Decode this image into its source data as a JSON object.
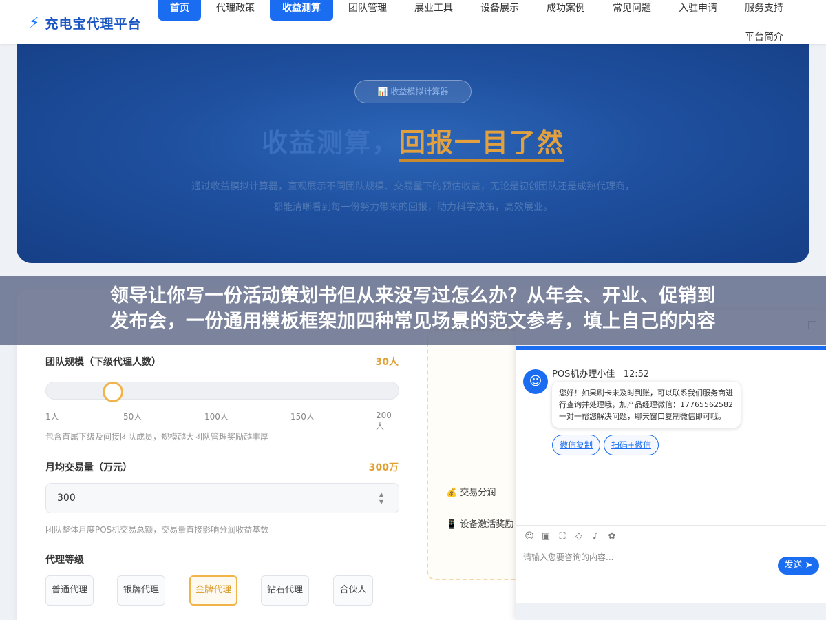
{
  "header": {
    "logo_icon": "⚡",
    "logo_text": "充电宝代理平台",
    "nav": [
      "首页",
      "代理政策",
      "收益测算",
      "团队管理",
      "展业工具",
      "设备展示",
      "成功案例",
      "常见问题",
      "入驻申请",
      "服务支持",
      "平台简介"
    ],
    "active_nav": [
      "首页",
      "收益测算"
    ]
  },
  "hero": {
    "badge": "📊 收益模拟计算器",
    "title_part1": "收益测算，",
    "title_part2": "回报一目了然",
    "description": "通过收益模拟计算器，直观展示不同团队规模、交易量下的预估收益，无论是初创团队还是成熟代理商，都能清晰看到每一份努力带来的回报，助力科学决策，高效展业。"
  },
  "banner": {
    "line1": "领导让你写一份活动策划书但从来没写过怎么办？从年会、开业、促销到",
    "line2": "发布会，一份通用模板框架加四种常见场景的范文参考，填上自己的内容"
  },
  "calculator": {
    "team_label": "团队规模（下级代理人数）",
    "team_value": "30人",
    "team_slider_fraction": 0.15,
    "team_ticks": [
      "1人",
      "50人",
      "100人",
      "150人",
      "200人"
    ],
    "team_hint": "包含直属下级及间接团队成员，规模越大团队管理奖励越丰厚",
    "volume_label": "月均交易量（万元）",
    "volume_value": "300万",
    "volume_input": "300",
    "volume_hint": "团队整体月度POS机交易总额，交易量直接影响分润收益基数",
    "level_label": "代理等级",
    "levels": [
      "普通代理",
      "银牌代理",
      "金牌代理",
      "钻石代理",
      "合伙人"
    ],
    "active_level": "金牌代理",
    "income_items": [
      "💰 交易分润",
      "📱 设备激活奖励"
    ]
  },
  "chat": {
    "agent_name": "POS机办理小佳",
    "time": "12:52",
    "message": "您好！如果刷卡未及时到账，可以联系我们服务商进行查询并处理哦，加产品经理微信：17765562582 一对一帮您解决问题，聊天窗口复制微信即可哦。",
    "buttons": [
      "微信复制",
      "扫码+微信"
    ],
    "tool_icons": [
      "emoji-icon",
      "image-icon",
      "screenshot-icon",
      "tag-icon",
      "voice-icon",
      "rating-icon"
    ],
    "input_placeholder": "请输入您要咨询的内容...",
    "send_label": "发送"
  },
  "colors": {
    "primary": "#1a6df0",
    "accent": "#f0b44a",
    "hero_bg": "#1e4f9e"
  }
}
